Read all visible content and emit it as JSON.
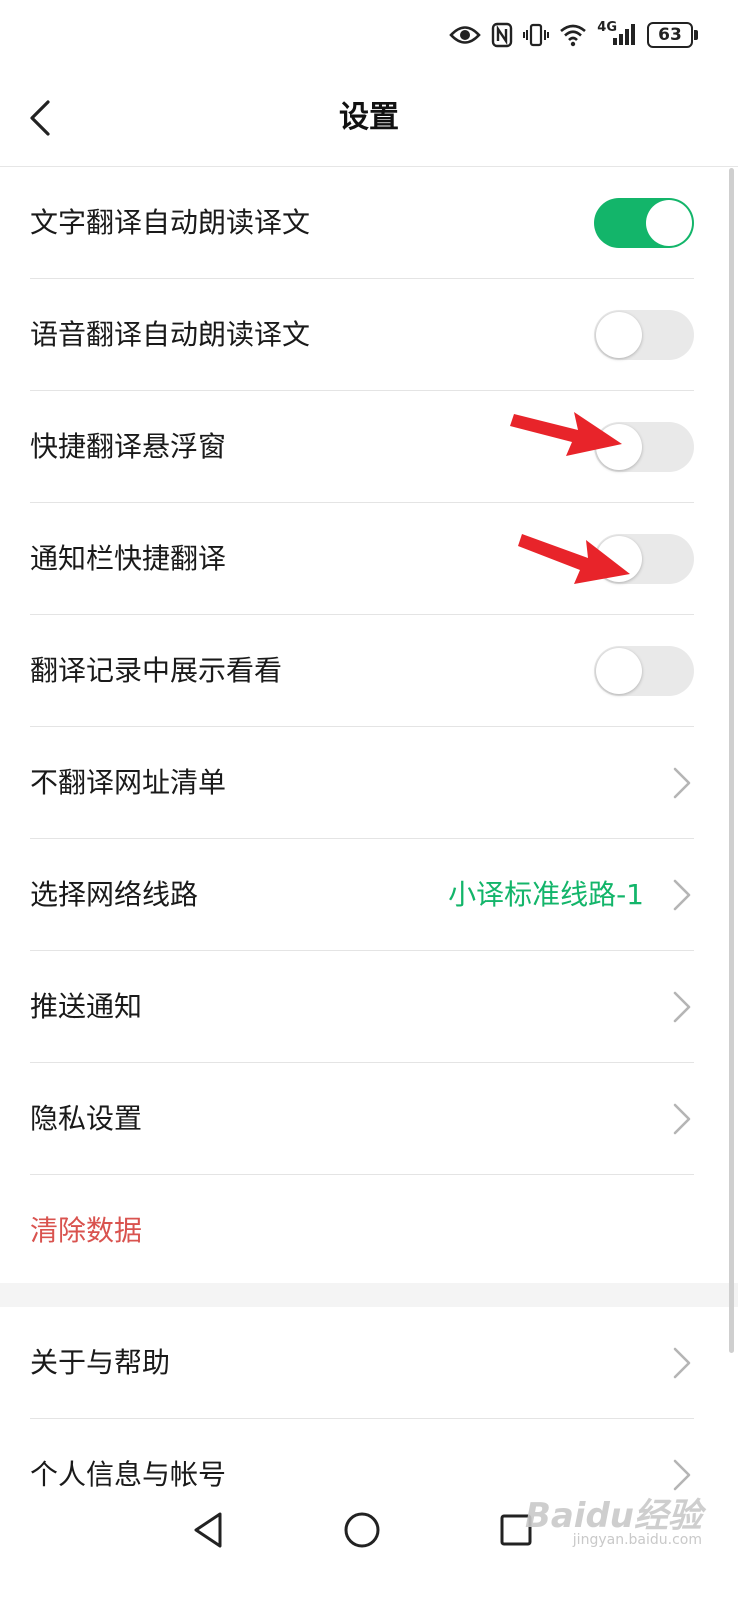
{
  "status_bar": {
    "network": "4G",
    "battery": "63",
    "icons": [
      "eye-icon",
      "nfc-icon",
      "vibrate-icon",
      "wifi-icon",
      "signal-icon",
      "battery-icon"
    ]
  },
  "header": {
    "title": "设置",
    "back_icon": "chevron-left-icon"
  },
  "settings": {
    "text_translate_autoread": {
      "label": "文字翻译自动朗读译文",
      "toggle_on": true
    },
    "voice_translate_autoread": {
      "label": "语音翻译自动朗读译文",
      "toggle_on": false
    },
    "quick_float_window": {
      "label": "快捷翻译悬浮窗",
      "toggle_on": false
    },
    "notification_quick_translate": {
      "label": "通知栏快捷翻译",
      "toggle_on": false
    },
    "show_in_history": {
      "label": "翻译记录中展示看看",
      "toggle_on": false
    },
    "no_translate_urls": {
      "label": "不翻译网址清单"
    },
    "network_route": {
      "label": "选择网络线路",
      "value": "小译标准线路-1"
    },
    "push_notification": {
      "label": "推送通知"
    },
    "privacy": {
      "label": "隐私设置"
    },
    "clear_data": {
      "label": "清除数据"
    },
    "about_help": {
      "label": "关于与帮助"
    },
    "account": {
      "label": "个人信息与帐号"
    }
  },
  "nav_bar": {
    "icons": [
      "back-triangle-icon",
      "home-circle-icon",
      "recents-square-icon"
    ]
  },
  "watermark": {
    "text": "Baidu经验",
    "sub": "jingyan.baidu.com"
  },
  "colors": {
    "accent_green": "#13b56a",
    "danger_red": "#d9534f",
    "annotation_red": "#e8242a",
    "toggle_off": "#e9e9e9"
  }
}
